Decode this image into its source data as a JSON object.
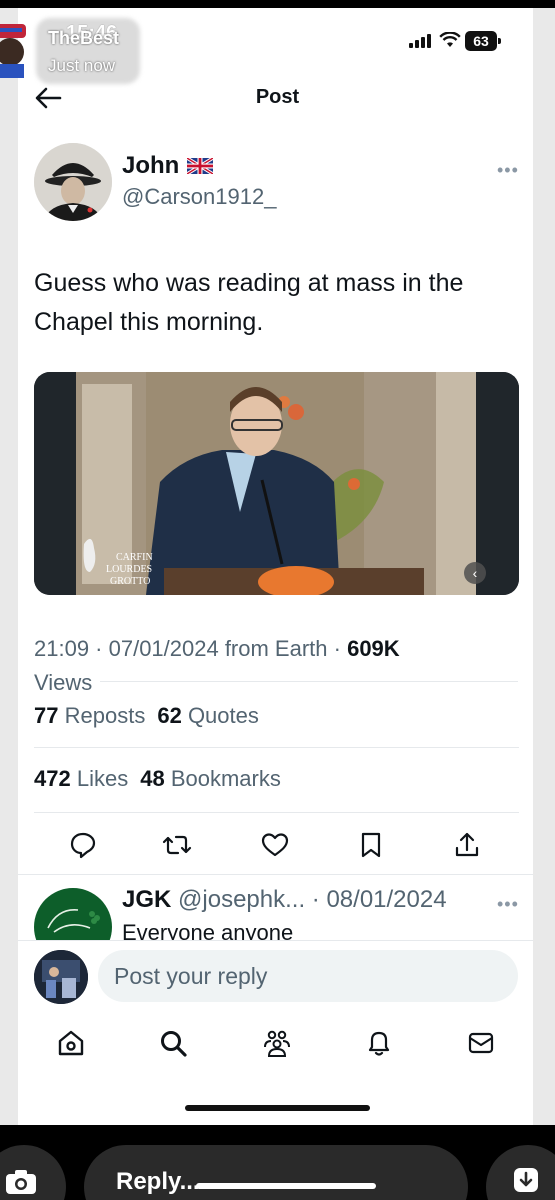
{
  "status_bar": {
    "time": "15:46",
    "battery": "63"
  },
  "notification": {
    "title": "TheBest",
    "subtitle": "Just now"
  },
  "header": {
    "title": "Post"
  },
  "post": {
    "author_name": "John",
    "author_flag": "uk-flag-icon",
    "author_handle": "@Carson1912_",
    "text": "Guess who was reading at mass in the Chapel this morning.",
    "media_watermark": [
      "CARFIN",
      "LOURDES",
      "GROTTO"
    ],
    "timestamp": "21:09 · 07/01/2024 from Earth · ",
    "views_count": "609K",
    "views_label": "Views",
    "reposts_count": "77",
    "reposts_label": "Reposts",
    "quotes_count": "62",
    "quotes_label": "Quotes",
    "likes_count": "472",
    "likes_label": "Likes",
    "bookmarks_count": "48",
    "bookmarks_label": "Bookmarks"
  },
  "reply_preview": {
    "author_name": "JGK",
    "handle_and_date": "@josephk... · 08/01/2024",
    "text": "Everyone anyone"
  },
  "compose": {
    "placeholder": "Post your reply"
  },
  "story_bar": {
    "reply_label": "Reply..."
  },
  "icons": {
    "tabs": [
      "home-icon",
      "search-icon",
      "communities-icon",
      "notifications-icon",
      "messages-icon"
    ],
    "actions": [
      "reply-icon",
      "repost-icon",
      "like-icon",
      "bookmark-icon",
      "share-icon"
    ]
  }
}
